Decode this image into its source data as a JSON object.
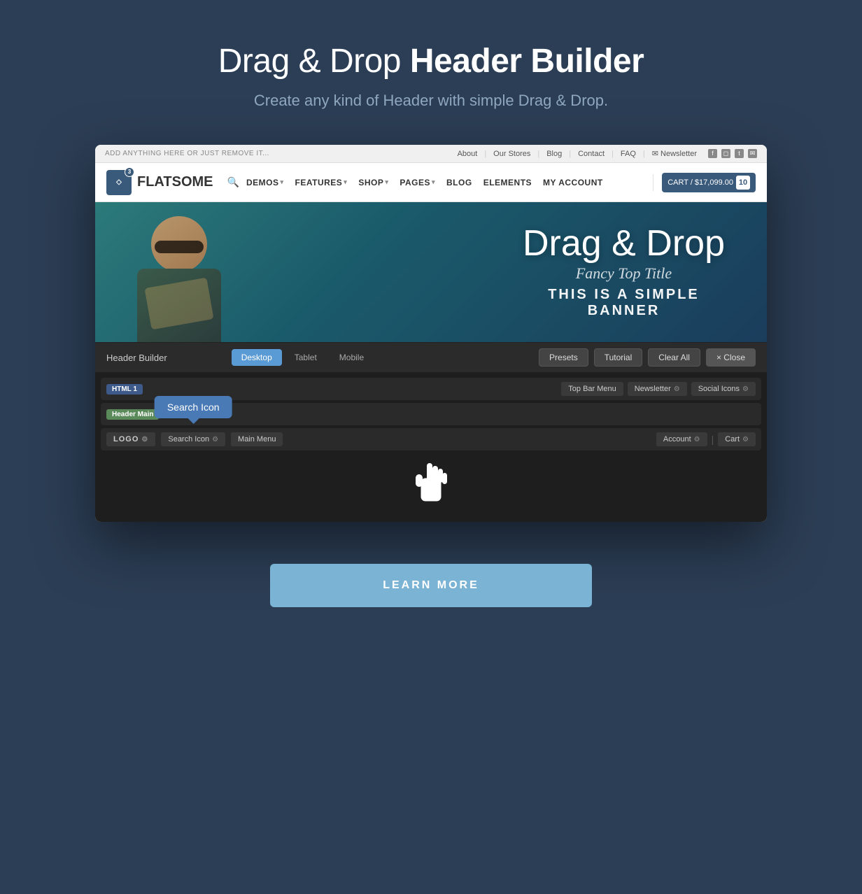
{
  "page": {
    "title_light": "Drag & Drop ",
    "title_bold": "Header Builder",
    "subtitle": "Create any kind of Header with simple Drag & Drop."
  },
  "topbar": {
    "left_text": "ADD ANYTHING HERE OR JUST REMOVE IT...",
    "nav_items": [
      "About",
      "Our Stores",
      "Blog",
      "Contact",
      "FAQ"
    ],
    "newsletter_label": "Newsletter"
  },
  "main_nav": {
    "logo_text": "FLATSOME",
    "logo_number": "3",
    "nav_items": [
      "DEMOS",
      "FEATURES",
      "SHOP",
      "PAGES",
      "BLOG",
      "ELEMENTS",
      "MY ACCOUNT"
    ],
    "cart_label": "CART / $17,099.00",
    "cart_count": "10"
  },
  "banner": {
    "title": "Drag & Drop",
    "fancy_title": "Fancy Top Title",
    "subtitle_line1": "THIS IS A SIMPLE",
    "subtitle_line2": "BANNER"
  },
  "header_builder": {
    "label": "Header Builder",
    "device_tabs": [
      "Desktop",
      "Tablet",
      "Mobile"
    ],
    "active_tab": "Desktop",
    "buttons": [
      "Presets",
      "Tutorial",
      "Clear All",
      "× Close"
    ],
    "html_label": "HTML 1",
    "header_main_label": "Header Main",
    "top_row_widgets": [
      "Top Bar Menu",
      "Newsletter",
      "Social Icons"
    ],
    "main_row_left": [
      "Search Icon",
      "Main Menu"
    ],
    "logo_label": "LOGO",
    "right_widgets": [
      "Account",
      "Cart"
    ],
    "tooltip_text": "Search Icon"
  },
  "learn_more": {
    "label": "LEARN MORE"
  }
}
